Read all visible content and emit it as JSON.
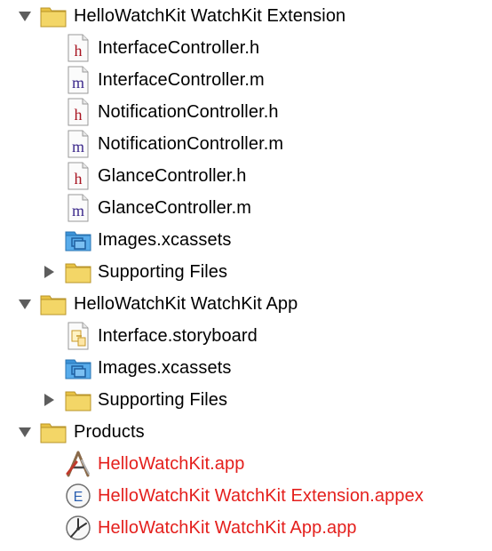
{
  "tree": {
    "group_ext": {
      "label": "HelloWatchKit WatchKit Extension",
      "files": [
        {
          "label": "InterfaceController.h",
          "icon": "header-file-icon"
        },
        {
          "label": "InterfaceController.m",
          "icon": "objc-file-icon"
        },
        {
          "label": "NotificationController.h",
          "icon": "header-file-icon"
        },
        {
          "label": "NotificationController.m",
          "icon": "objc-file-icon"
        },
        {
          "label": "GlanceController.h",
          "icon": "header-file-icon"
        },
        {
          "label": "GlanceController.m",
          "icon": "objc-file-icon"
        },
        {
          "label": "Images.xcassets",
          "icon": "asset-catalog-icon"
        }
      ],
      "supporting": {
        "label": "Supporting Files",
        "icon": "folder-icon"
      }
    },
    "group_app": {
      "label": "HelloWatchKit WatchKit App",
      "files": [
        {
          "label": "Interface.storyboard",
          "icon": "storyboard-file-icon"
        },
        {
          "label": "Images.xcassets",
          "icon": "asset-catalog-icon"
        }
      ],
      "supporting": {
        "label": "Supporting Files",
        "icon": "folder-icon"
      }
    },
    "group_products": {
      "label": "Products",
      "files": [
        {
          "label": "HelloWatchKit.app",
          "icon": "app-bundle-icon"
        },
        {
          "label": "HelloWatchKit WatchKit Extension.appex",
          "icon": "extension-bundle-icon"
        },
        {
          "label": "HelloWatchKit WatchKit App.app",
          "icon": "watch-app-icon"
        }
      ]
    }
  },
  "colors": {
    "product_missing": "#e41f1c",
    "folder": "#f0d058",
    "folder_edge": "#c9a52c",
    "asset_catalog": "#4ca4e6",
    "header_letter": "#a8121f",
    "impl_letter": "#3d2a8c",
    "disclosure": "#5d5d5d"
  }
}
